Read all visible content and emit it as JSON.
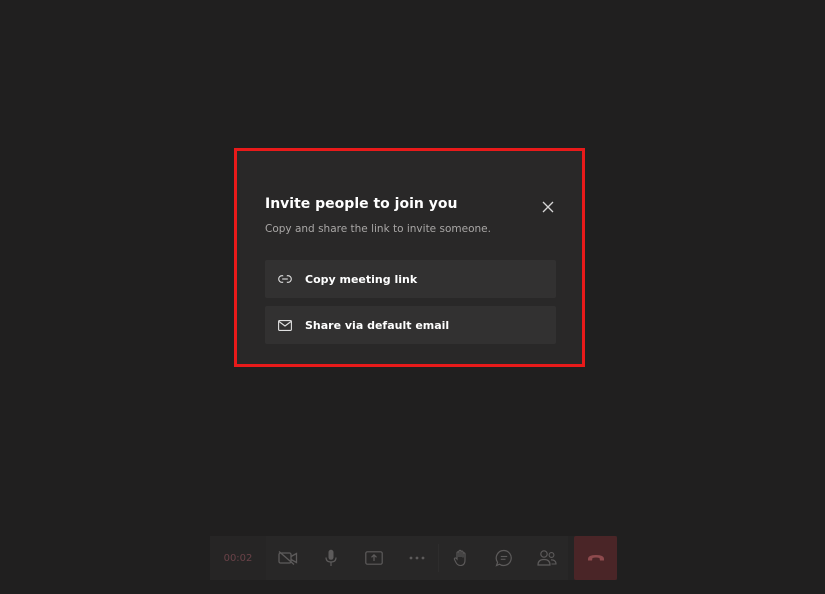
{
  "dialog": {
    "title": "Invite people to join you",
    "subtitle": "Copy and share the link to invite someone.",
    "close_icon": "close-icon",
    "options": [
      {
        "label": "Copy meeting link",
        "icon": "link-icon"
      },
      {
        "label": "Share via default email",
        "icon": "mail-icon"
      }
    ]
  },
  "toolbar": {
    "timer": "00:02",
    "buttons": [
      {
        "name": "camera-off",
        "icon": "camera-off-icon"
      },
      {
        "name": "microphone",
        "icon": "microphone-icon"
      },
      {
        "name": "share-screen",
        "icon": "share-screen-icon"
      },
      {
        "name": "more-actions",
        "icon": "more-icon"
      },
      {
        "name": "raise-hand",
        "icon": "hand-icon"
      },
      {
        "name": "chat",
        "icon": "chat-icon"
      },
      {
        "name": "participants",
        "icon": "people-icon"
      },
      {
        "name": "hang-up",
        "icon": "hang-up-icon"
      }
    ]
  },
  "colors": {
    "background": "#201f1f",
    "dialog": "#292828",
    "option": "#323131",
    "highlight": "#e81a1a",
    "hangup": "#4a2527"
  }
}
